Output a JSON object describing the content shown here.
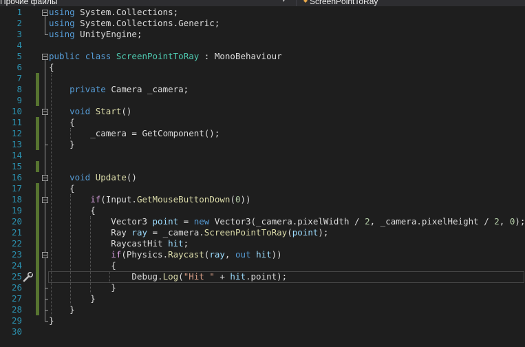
{
  "breadcrumb": {
    "left": "Прочие файлы",
    "right": "ScreenPointToRay"
  },
  "theme": {
    "background": "#1e1e1e",
    "line_number": "#2b91af",
    "keyword": "#569cd6",
    "type": "#4ec9b0",
    "control": "#d8a0df",
    "method": "#dcdcaa",
    "variable": "#9cdcfe",
    "string": "#d69d85",
    "number": "#b5cea8",
    "changed_marker": "#577430"
  },
  "icons": {
    "breadcrumb_class": "class-icon",
    "gutter_action": "screwdriver-icon",
    "dropdown": "chevron-down-icon"
  },
  "lines": [
    {
      "num": "1",
      "tokens": [
        {
          "t": "using",
          "c": "kw"
        },
        {
          "t": " System.Collections;",
          "c": "plain"
        }
      ]
    },
    {
      "num": "2",
      "tokens": [
        {
          "t": "using",
          "c": "kw"
        },
        {
          "t": " System.Collections.Generic;",
          "c": "plain"
        }
      ]
    },
    {
      "num": "3",
      "tokens": [
        {
          "t": "using",
          "c": "kw"
        },
        {
          "t": " UnityEngine;",
          "c": "plain"
        }
      ]
    },
    {
      "num": "4",
      "tokens": []
    },
    {
      "num": "5",
      "tokens": [
        {
          "t": "public",
          "c": "kw"
        },
        {
          "t": " ",
          "c": "plain"
        },
        {
          "t": "class",
          "c": "kw"
        },
        {
          "t": " ",
          "c": "plain"
        },
        {
          "t": "ScreenPointToRay",
          "c": "type"
        },
        {
          "t": " : MonoBehaviour",
          "c": "plain"
        }
      ]
    },
    {
      "num": "6",
      "tokens": [
        {
          "t": "{",
          "c": "plain"
        }
      ]
    },
    {
      "num": "7",
      "tokens": []
    },
    {
      "num": "8",
      "tokens": [
        {
          "t": "    ",
          "c": "plain"
        },
        {
          "t": "private",
          "c": "kw"
        },
        {
          "t": " Camera _camera;",
          "c": "plain"
        }
      ]
    },
    {
      "num": "9",
      "tokens": []
    },
    {
      "num": "10",
      "tokens": [
        {
          "t": "    ",
          "c": "plain"
        },
        {
          "t": "void",
          "c": "kw"
        },
        {
          "t": " ",
          "c": "plain"
        },
        {
          "t": "Start",
          "c": "method"
        },
        {
          "t": "()",
          "c": "plain"
        }
      ]
    },
    {
      "num": "11",
      "tokens": [
        {
          "t": "    {",
          "c": "plain"
        }
      ]
    },
    {
      "num": "12",
      "tokens": [
        {
          "t": "        _camera = GetComponent();",
          "c": "plain"
        }
      ]
    },
    {
      "num": "13",
      "tokens": [
        {
          "t": "    }",
          "c": "plain"
        }
      ]
    },
    {
      "num": "14",
      "tokens": []
    },
    {
      "num": "15",
      "tokens": []
    },
    {
      "num": "16",
      "tokens": [
        {
          "t": "    ",
          "c": "plain"
        },
        {
          "t": "void",
          "c": "kw"
        },
        {
          "t": " ",
          "c": "plain"
        },
        {
          "t": "Update",
          "c": "method"
        },
        {
          "t": "()",
          "c": "plain"
        }
      ]
    },
    {
      "num": "17",
      "tokens": [
        {
          "t": "    {",
          "c": "plain"
        }
      ]
    },
    {
      "num": "18",
      "tokens": [
        {
          "t": "        ",
          "c": "plain"
        },
        {
          "t": "if",
          "c": "ctrl"
        },
        {
          "t": "(Input.",
          "c": "plain"
        },
        {
          "t": "GetMouseButtonDown",
          "c": "method"
        },
        {
          "t": "(",
          "c": "plain"
        },
        {
          "t": "0",
          "c": "num"
        },
        {
          "t": "))",
          "c": "plain"
        }
      ]
    },
    {
      "num": "19",
      "tokens": [
        {
          "t": "        {",
          "c": "plain"
        }
      ]
    },
    {
      "num": "20",
      "tokens": [
        {
          "t": "            Vector3 ",
          "c": "plain"
        },
        {
          "t": "point",
          "c": "var"
        },
        {
          "t": " = ",
          "c": "plain"
        },
        {
          "t": "new",
          "c": "kw"
        },
        {
          "t": " Vector3(_camera.pixelWidth / ",
          "c": "plain"
        },
        {
          "t": "2",
          "c": "num"
        },
        {
          "t": ", _camera.pixelHeight / ",
          "c": "plain"
        },
        {
          "t": "2",
          "c": "num"
        },
        {
          "t": ", ",
          "c": "plain"
        },
        {
          "t": "0",
          "c": "num"
        },
        {
          "t": ");",
          "c": "plain"
        }
      ]
    },
    {
      "num": "21",
      "tokens": [
        {
          "t": "            Ray ",
          "c": "plain"
        },
        {
          "t": "ray",
          "c": "var"
        },
        {
          "t": " = _camera.",
          "c": "plain"
        },
        {
          "t": "ScreenPointToRay",
          "c": "method"
        },
        {
          "t": "(",
          "c": "plain"
        },
        {
          "t": "point",
          "c": "var"
        },
        {
          "t": ");",
          "c": "plain"
        }
      ]
    },
    {
      "num": "22",
      "tokens": [
        {
          "t": "            RaycastHit ",
          "c": "plain"
        },
        {
          "t": "hit",
          "c": "var"
        },
        {
          "t": ";",
          "c": "plain"
        }
      ]
    },
    {
      "num": "23",
      "tokens": [
        {
          "t": "            ",
          "c": "plain"
        },
        {
          "t": "if",
          "c": "ctrl"
        },
        {
          "t": "(Physics.",
          "c": "plain"
        },
        {
          "t": "Raycast",
          "c": "method"
        },
        {
          "t": "(",
          "c": "plain"
        },
        {
          "t": "ray",
          "c": "var"
        },
        {
          "t": ", ",
          "c": "plain"
        },
        {
          "t": "out",
          "c": "kw"
        },
        {
          "t": " ",
          "c": "plain"
        },
        {
          "t": "hit",
          "c": "var"
        },
        {
          "t": "))",
          "c": "plain"
        }
      ]
    },
    {
      "num": "24",
      "tokens": [
        {
          "t": "            {",
          "c": "plain"
        }
      ]
    },
    {
      "num": "25",
      "tokens": [
        {
          "t": "                Debug.",
          "c": "plain"
        },
        {
          "t": "Log",
          "c": "method"
        },
        {
          "t": "(",
          "c": "plain"
        },
        {
          "t": "\"Hit \"",
          "c": "str"
        },
        {
          "t": " + ",
          "c": "plain"
        },
        {
          "t": "hit",
          "c": "var"
        },
        {
          "t": ".point);",
          "c": "plain"
        }
      ]
    },
    {
      "num": "26",
      "tokens": [
        {
          "t": "            }",
          "c": "plain"
        }
      ]
    },
    {
      "num": "27",
      "tokens": [
        {
          "t": "        }",
          "c": "plain"
        }
      ]
    },
    {
      "num": "28",
      "tokens": [
        {
          "t": "    }",
          "c": "plain"
        }
      ]
    },
    {
      "num": "29",
      "tokens": [
        {
          "t": "}",
          "c": "plain"
        }
      ]
    },
    {
      "num": "30",
      "tokens": []
    }
  ],
  "changed_lines": [
    "7",
    "8",
    "9",
    "11",
    "12",
    "13",
    "15",
    "17",
    "18",
    "19",
    "20",
    "21",
    "22",
    "23",
    "24",
    "25",
    "26",
    "27",
    "28"
  ],
  "fold_starts": [
    "1",
    "5",
    "10",
    "16",
    "18",
    "23"
  ],
  "current_line": "25"
}
